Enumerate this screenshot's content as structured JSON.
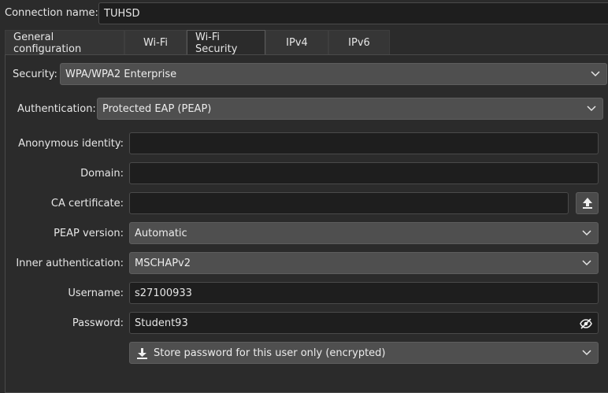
{
  "connection": {
    "label": "Connection name:",
    "value": "TUHSD"
  },
  "tabs": [
    {
      "label": "General configuration"
    },
    {
      "label": "Wi-Fi"
    },
    {
      "label": "Wi-Fi Security"
    },
    {
      "label": "IPv4"
    },
    {
      "label": "IPv6"
    }
  ],
  "security": {
    "label": "Security:",
    "value": "WPA/WPA2 Enterprise"
  },
  "authentication": {
    "label": "Authentication:",
    "value": "Protected EAP (PEAP)"
  },
  "fields": {
    "anonymous_identity": {
      "label": "Anonymous identity:",
      "value": ""
    },
    "domain": {
      "label": "Domain:",
      "value": ""
    },
    "ca_certificate": {
      "label": "CA certificate:",
      "value": ""
    },
    "peap_version": {
      "label": "PEAP version:",
      "value": "Automatic"
    },
    "inner_auth": {
      "label": "Inner authentication:",
      "value": "MSCHAPv2"
    },
    "username": {
      "label": "Username:",
      "value": "s27100933"
    },
    "password": {
      "label": "Password:",
      "value": "Student93"
    },
    "store_password": {
      "value": "Store password for this user only (encrypted)"
    }
  },
  "icons": {
    "upload": "upload-icon",
    "eye": "eye-slash-icon",
    "chevron": "chevron-down-icon",
    "download": "download-icon"
  },
  "colors": {
    "background": "#2b2b2b",
    "input_bg": "#1e1e1e",
    "combo_bg": "#4f4f4f"
  }
}
